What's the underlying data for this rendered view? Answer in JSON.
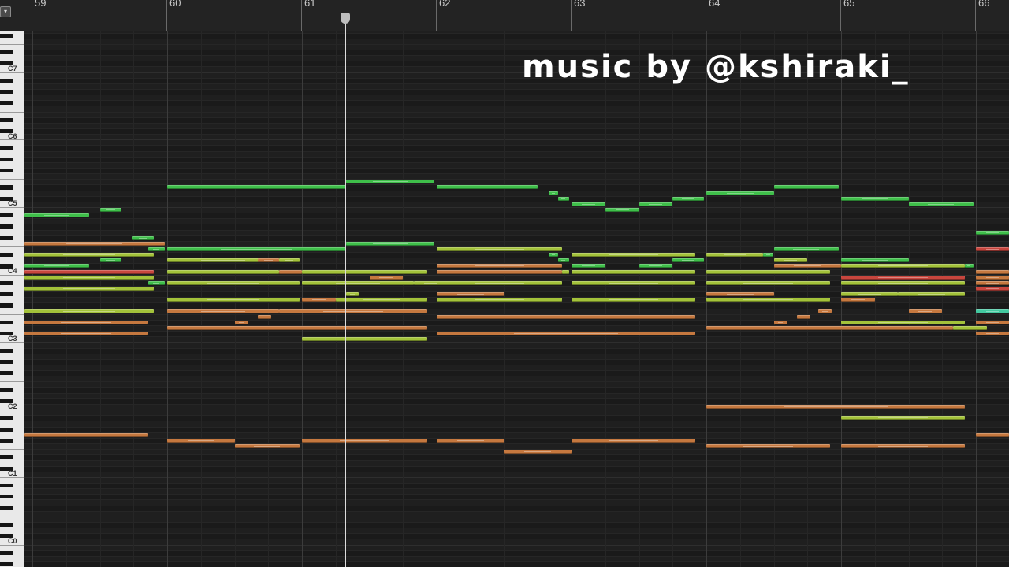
{
  "ruler": {
    "bar_numbers": [
      "59",
      "60",
      "61",
      "62",
      "63",
      "64",
      "65",
      "66"
    ],
    "menu_icon": "chevron-down-icon"
  },
  "keyboard": {
    "c_labels": [
      "C7",
      "C6",
      "C5",
      "C4",
      "C3",
      "C2",
      "C1",
      "C0"
    ]
  },
  "playhead": {
    "position_bar": 61.33
  },
  "overlay": {
    "watermark": "music by @kshiraki_"
  },
  "colors": {
    "background": "#1e1e1e",
    "green": "#3fbf4a",
    "lime": "#a3c23a",
    "orange": "#c5783f",
    "red": "#c8463e",
    "teal": "#43c9a0",
    "playhead": "#dcdcdc"
  },
  "notes": [
    {
      "pitch": "G4",
      "start": 58.87,
      "end": 58.93,
      "color": "green"
    },
    {
      "pitch": "A#4",
      "start": 58.93,
      "end": 59.42,
      "color": "green"
    },
    {
      "pitch": "B4",
      "start": 59.5,
      "end": 59.66,
      "color": "green"
    },
    {
      "pitch": "F#4",
      "start": 59.74,
      "end": 59.9,
      "color": "green"
    },
    {
      "pitch": "F4",
      "start": 58.93,
      "end": 59.98,
      "color": "orange"
    },
    {
      "pitch": "E4",
      "start": 59.86,
      "end": 59.98,
      "color": "green"
    },
    {
      "pitch": "D#4",
      "start": 58.93,
      "end": 59.9,
      "color": "lime"
    },
    {
      "pitch": "D4",
      "start": 59.5,
      "end": 59.66,
      "color": "green"
    },
    {
      "pitch": "C#4",
      "start": 58.93,
      "end": 59.42,
      "color": "green"
    },
    {
      "pitch": "C4",
      "start": 58.87,
      "end": 58.93,
      "color": "green"
    },
    {
      "pitch": "C4",
      "start": 58.93,
      "end": 59.9,
      "color": "red"
    },
    {
      "pitch": "B3",
      "start": 58.93,
      "end": 59.9,
      "color": "lime"
    },
    {
      "pitch": "A#3",
      "start": 59.86,
      "end": 59.98,
      "color": "green"
    },
    {
      "pitch": "A3",
      "start": 58.93,
      "end": 59.9,
      "color": "lime"
    },
    {
      "pitch": "F3",
      "start": 58.93,
      "end": 59.9,
      "color": "lime"
    },
    {
      "pitch": "D#3",
      "start": 58.85,
      "end": 59.86,
      "color": "orange"
    },
    {
      "pitch": "C#3",
      "start": 58.85,
      "end": 59.86,
      "color": "orange"
    },
    {
      "pitch": "G1",
      "start": 58.93,
      "end": 59.86,
      "color": "orange"
    },
    {
      "pitch": "F1",
      "start": 58.85,
      "end": 58.9,
      "color": "orange"
    },
    {
      "pitch": "D#5",
      "start": 60.0,
      "end": 61.33,
      "color": "green"
    },
    {
      "pitch": "E4",
      "start": 60.0,
      "end": 61.33,
      "color": "green"
    },
    {
      "pitch": "D4",
      "start": 60.0,
      "end": 60.83,
      "color": "lime"
    },
    {
      "pitch": "D4",
      "start": 60.67,
      "end": 60.83,
      "color": "orange"
    },
    {
      "pitch": "D4",
      "start": 60.83,
      "end": 60.98,
      "color": "lime"
    },
    {
      "pitch": "C4",
      "start": 60.0,
      "end": 60.83,
      "color": "lime"
    },
    {
      "pitch": "C4",
      "start": 60.83,
      "end": 61.0,
      "color": "orange"
    },
    {
      "pitch": "C4",
      "start": 61.0,
      "end": 61.93,
      "color": "lime"
    },
    {
      "pitch": "A#3",
      "start": 60.0,
      "end": 60.98,
      "color": "lime"
    },
    {
      "pitch": "A#3",
      "start": 61.0,
      "end": 61.83,
      "color": "lime"
    },
    {
      "pitch": "A#3",
      "start": 61.83,
      "end": 62.08,
      "color": "lime"
    },
    {
      "pitch": "G#3",
      "start": 61.33,
      "end": 61.42,
      "color": "lime"
    },
    {
      "pitch": "G3",
      "start": 60.0,
      "end": 60.98,
      "color": "lime"
    },
    {
      "pitch": "G3",
      "start": 61.0,
      "end": 61.25,
      "color": "orange"
    },
    {
      "pitch": "G3",
      "start": 61.25,
      "end": 61.93,
      "color": "lime"
    },
    {
      "pitch": "F3",
      "start": 60.0,
      "end": 60.83,
      "color": "orange"
    },
    {
      "pitch": "F3",
      "start": 60.83,
      "end": 61.93,
      "color": "orange"
    },
    {
      "pitch": "E3",
      "start": 60.67,
      "end": 60.77,
      "color": "orange"
    },
    {
      "pitch": "D#3",
      "start": 60.5,
      "end": 60.6,
      "color": "orange"
    },
    {
      "pitch": "D3",
      "start": 60.0,
      "end": 61.93,
      "color": "orange"
    },
    {
      "pitch": "C3",
      "start": 61.0,
      "end": 61.93,
      "color": "lime"
    },
    {
      "pitch": "F#1",
      "start": 60.0,
      "end": 60.5,
      "color": "orange"
    },
    {
      "pitch": "F#1",
      "start": 61.0,
      "end": 61.93,
      "color": "orange"
    },
    {
      "pitch": "F1",
      "start": 60.5,
      "end": 60.98,
      "color": "orange"
    },
    {
      "pitch": "E5",
      "start": 61.33,
      "end": 61.98,
      "color": "green"
    },
    {
      "pitch": "F4",
      "start": 61.33,
      "end": 61.98,
      "color": "green"
    },
    {
      "pitch": "B3",
      "start": 61.5,
      "end": 61.75,
      "color": "orange"
    },
    {
      "pitch": "D#5",
      "start": 62.0,
      "end": 62.75,
      "color": "green"
    },
    {
      "pitch": "E4",
      "start": 62.0,
      "end": 62.93,
      "color": "lime"
    },
    {
      "pitch": "C#4",
      "start": 62.0,
      "end": 62.93,
      "color": "orange"
    },
    {
      "pitch": "C4",
      "start": 62.0,
      "end": 62.93,
      "color": "orange"
    },
    {
      "pitch": "A#3",
      "start": 62.0,
      "end": 62.93,
      "color": "lime"
    },
    {
      "pitch": "G#3",
      "start": 62.0,
      "end": 62.5,
      "color": "orange"
    },
    {
      "pitch": "G3",
      "start": 62.0,
      "end": 62.93,
      "color": "lime"
    },
    {
      "pitch": "E3",
      "start": 62.0,
      "end": 63.92,
      "color": "orange"
    },
    {
      "pitch": "C#3",
      "start": 62.0,
      "end": 63.92,
      "color": "orange"
    },
    {
      "pitch": "F#1",
      "start": 62.0,
      "end": 62.5,
      "color": "orange"
    },
    {
      "pitch": "E1",
      "start": 62.5,
      "end": 63.0,
      "color": "orange"
    },
    {
      "pitch": "D5",
      "start": 62.83,
      "end": 62.9,
      "color": "green"
    },
    {
      "pitch": "C#5",
      "start": 62.9,
      "end": 62.98,
      "color": "green"
    },
    {
      "pitch": "D#4",
      "start": 62.83,
      "end": 62.9,
      "color": "green"
    },
    {
      "pitch": "D4",
      "start": 62.9,
      "end": 62.98,
      "color": "green"
    },
    {
      "pitch": "C4",
      "start": 62.93,
      "end": 62.98,
      "color": "lime"
    },
    {
      "pitch": "C5",
      "start": 63.0,
      "end": 63.25,
      "color": "green"
    },
    {
      "pitch": "B4",
      "start": 63.25,
      "end": 63.5,
      "color": "green"
    },
    {
      "pitch": "C5",
      "start": 63.5,
      "end": 63.75,
      "color": "green"
    },
    {
      "pitch": "C#5",
      "start": 63.75,
      "end": 63.98,
      "color": "green"
    },
    {
      "pitch": "D#4",
      "start": 63.0,
      "end": 63.92,
      "color": "lime"
    },
    {
      "pitch": "D4",
      "start": 63.75,
      "end": 63.98,
      "color": "green"
    },
    {
      "pitch": "C#4",
      "start": 63.0,
      "end": 63.25,
      "color": "green"
    },
    {
      "pitch": "C#4",
      "start": 63.5,
      "end": 63.75,
      "color": "green"
    },
    {
      "pitch": "C4",
      "start": 63.0,
      "end": 63.92,
      "color": "lime"
    },
    {
      "pitch": "A#3",
      "start": 63.0,
      "end": 63.92,
      "color": "lime"
    },
    {
      "pitch": "G3",
      "start": 63.0,
      "end": 63.92,
      "color": "lime"
    },
    {
      "pitch": "F#1",
      "start": 63.0,
      "end": 63.92,
      "color": "orange"
    },
    {
      "pitch": "D5",
      "start": 64.0,
      "end": 64.5,
      "color": "green"
    },
    {
      "pitch": "D#5",
      "start": 64.5,
      "end": 64.98,
      "color": "green"
    },
    {
      "pitch": "E4",
      "start": 64.5,
      "end": 64.98,
      "color": "green"
    },
    {
      "pitch": "D#4",
      "start": 64.0,
      "end": 64.42,
      "color": "lime"
    },
    {
      "pitch": "D#4",
      "start": 64.42,
      "end": 64.5,
      "color": "green"
    },
    {
      "pitch": "D4",
      "start": 64.5,
      "end": 64.75,
      "color": "lime"
    },
    {
      "pitch": "C#4",
      "start": 64.5,
      "end": 65.0,
      "color": "orange"
    },
    {
      "pitch": "C4",
      "start": 64.0,
      "end": 64.92,
      "color": "lime"
    },
    {
      "pitch": "A#3",
      "start": 64.0,
      "end": 64.92,
      "color": "lime"
    },
    {
      "pitch": "G#3",
      "start": 64.0,
      "end": 64.5,
      "color": "orange"
    },
    {
      "pitch": "G3",
      "start": 64.0,
      "end": 64.92,
      "color": "lime"
    },
    {
      "pitch": "F3",
      "start": 64.83,
      "end": 64.93,
      "color": "orange"
    },
    {
      "pitch": "E3",
      "start": 64.67,
      "end": 64.77,
      "color": "orange"
    },
    {
      "pitch": "D#3",
      "start": 64.5,
      "end": 64.6,
      "color": "orange"
    },
    {
      "pitch": "D3",
      "start": 64.0,
      "end": 65.83,
      "color": "orange"
    },
    {
      "pitch": "C2",
      "start": 64.0,
      "end": 65.92,
      "color": "orange"
    },
    {
      "pitch": "F1",
      "start": 64.0,
      "end": 64.92,
      "color": "orange"
    },
    {
      "pitch": "C#5",
      "start": 65.0,
      "end": 65.5,
      "color": "green"
    },
    {
      "pitch": "C5",
      "start": 65.5,
      "end": 65.98,
      "color": "green"
    },
    {
      "pitch": "D4",
      "start": 65.0,
      "end": 65.5,
      "color": "green"
    },
    {
      "pitch": "C#4",
      "start": 65.0,
      "end": 65.92,
      "color": "lime"
    },
    {
      "pitch": "C#4",
      "start": 65.92,
      "end": 65.98,
      "color": "green"
    },
    {
      "pitch": "B3",
      "start": 65.0,
      "end": 65.92,
      "color": "red"
    },
    {
      "pitch": "A#3",
      "start": 65.0,
      "end": 65.92,
      "color": "lime"
    },
    {
      "pitch": "G#3",
      "start": 65.0,
      "end": 65.42,
      "color": "lime"
    },
    {
      "pitch": "G#3",
      "start": 65.42,
      "end": 65.92,
      "color": "lime"
    },
    {
      "pitch": "G3",
      "start": 65.0,
      "end": 65.25,
      "color": "orange"
    },
    {
      "pitch": "F3",
      "start": 65.5,
      "end": 65.75,
      "color": "orange"
    },
    {
      "pitch": "D#3",
      "start": 65.0,
      "end": 65.92,
      "color": "lime"
    },
    {
      "pitch": "D3",
      "start": 65.83,
      "end": 66.08,
      "color": "lime"
    },
    {
      "pitch": "A#1",
      "start": 65.0,
      "end": 65.92,
      "color": "lime"
    },
    {
      "pitch": "F1",
      "start": 65.0,
      "end": 65.92,
      "color": "orange"
    },
    {
      "pitch": "G4",
      "start": 66.0,
      "end": 66.3,
      "color": "green"
    },
    {
      "pitch": "E4",
      "start": 66.0,
      "end": 66.3,
      "color": "red"
    },
    {
      "pitch": "C4",
      "start": 66.0,
      "end": 66.3,
      "color": "orange"
    },
    {
      "pitch": "B3",
      "start": 66.0,
      "end": 66.3,
      "color": "orange"
    },
    {
      "pitch": "A#3",
      "start": 66.0,
      "end": 66.3,
      "color": "orange"
    },
    {
      "pitch": "A3",
      "start": 66.0,
      "end": 66.3,
      "color": "red"
    },
    {
      "pitch": "F3",
      "start": 66.0,
      "end": 66.3,
      "color": "teal"
    },
    {
      "pitch": "D#3",
      "start": 66.0,
      "end": 66.3,
      "color": "orange"
    },
    {
      "pitch": "C#3",
      "start": 66.0,
      "end": 66.3,
      "color": "orange"
    },
    {
      "pitch": "G1",
      "start": 66.0,
      "end": 66.3,
      "color": "orange"
    }
  ]
}
